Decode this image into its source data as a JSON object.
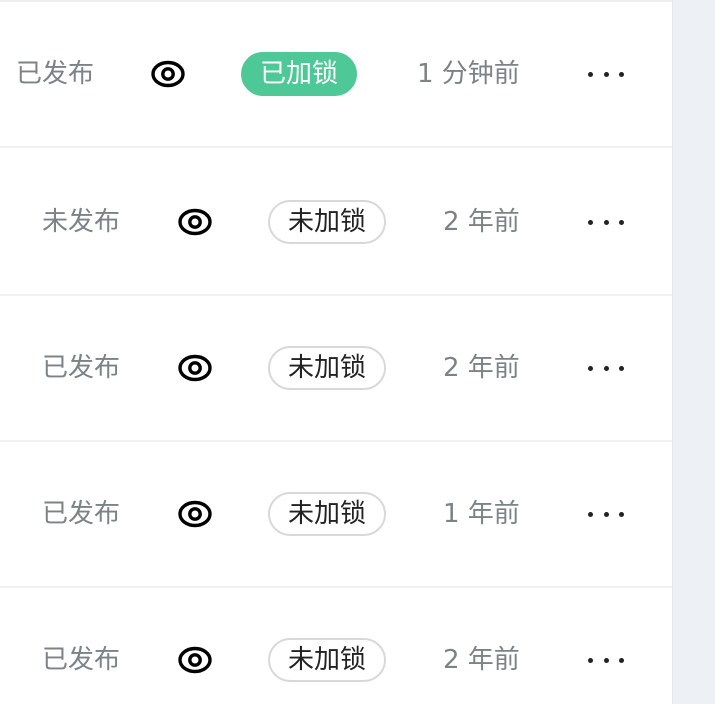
{
  "rows": [
    {
      "publish_status": "已发布",
      "view_icon": "eye-icon",
      "lock_status": "已加锁",
      "locked": true,
      "updated": "1 分钟前",
      "more_icon": "more-icon"
    },
    {
      "publish_status": "未发布",
      "view_icon": "eye-icon",
      "lock_status": "未加锁",
      "locked": false,
      "updated": "2 年前",
      "more_icon": "more-icon"
    },
    {
      "publish_status": "已发布",
      "view_icon": "eye-icon",
      "lock_status": "未加锁",
      "locked": false,
      "updated": "2 年前",
      "more_icon": "more-icon"
    },
    {
      "publish_status": "已发布",
      "view_icon": "eye-icon",
      "lock_status": "未加锁",
      "locked": false,
      "updated": "1 年前",
      "more_icon": "more-icon"
    },
    {
      "publish_status": "已发布",
      "view_icon": "eye-icon",
      "lock_status": "未加锁",
      "locked": false,
      "updated": "2 年前",
      "more_icon": "more-icon"
    }
  ],
  "colors": {
    "locked_badge": "#4dc896",
    "muted_text": "#7d8288",
    "gutter": "#edf1f6"
  }
}
